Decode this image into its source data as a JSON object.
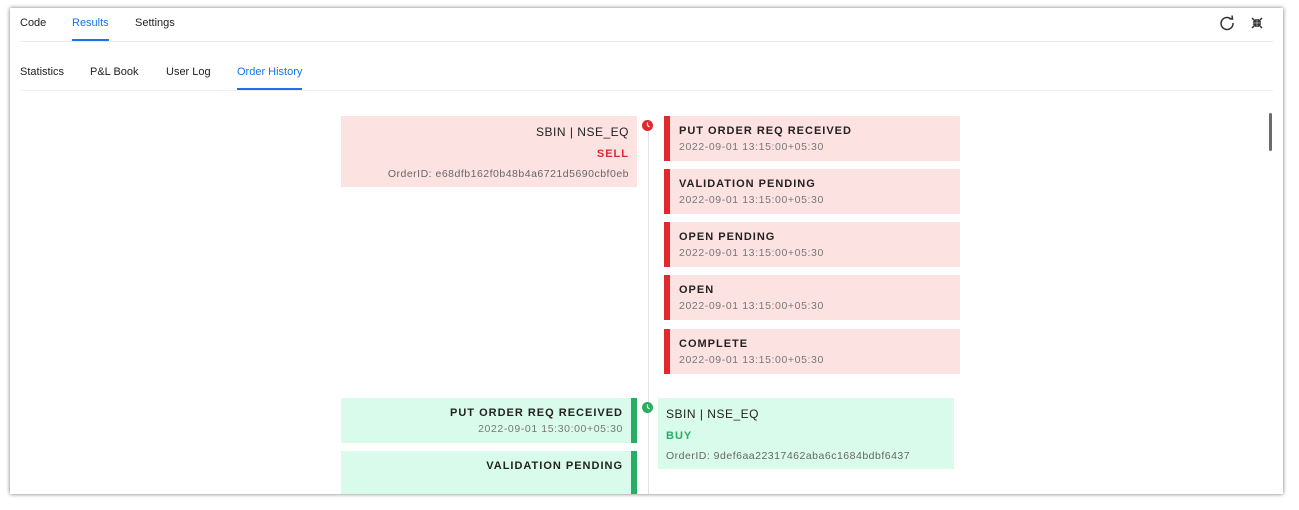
{
  "tabs": [
    {
      "label": "Code",
      "active": false
    },
    {
      "label": "Results",
      "active": true
    },
    {
      "label": "Settings",
      "active": false
    }
  ],
  "subtabs": [
    {
      "label": "Statistics",
      "active": false
    },
    {
      "label": "P&L Book",
      "active": false
    },
    {
      "label": "User Log",
      "active": false
    },
    {
      "label": "Order History",
      "active": true
    }
  ],
  "toolbar_icons": [
    "refresh-icon",
    "collapse-icon"
  ],
  "colors": {
    "accent": "#1a73e8",
    "sell": "#e0282e",
    "buy": "#27ae60",
    "sell_bg": "#fde2e2",
    "buy_bg": "#d9fbec"
  },
  "orders": [
    {
      "symbol": "SBIN | NSE_EQ",
      "side": "SELL",
      "order_id": "OrderID: e68dfb162f0b48b4a6721d5690cbf0eb",
      "statuses": [
        {
          "name": "PUT ORDER REQ RECEIVED",
          "time": "2022-09-01 13:15:00+05:30"
        },
        {
          "name": "VALIDATION PENDING",
          "time": "2022-09-01 13:15:00+05:30"
        },
        {
          "name": "OPEN PENDING",
          "time": "2022-09-01 13:15:00+05:30"
        },
        {
          "name": "OPEN",
          "time": "2022-09-01 13:15:00+05:30"
        },
        {
          "name": "COMPLETE",
          "time": "2022-09-01 13:15:00+05:30"
        }
      ]
    },
    {
      "symbol": "SBIN | NSE_EQ",
      "side": "BUY",
      "order_id": "OrderID: 9def6aa22317462aba6c1684bdbf6437",
      "statuses": [
        {
          "name": "PUT ORDER REQ RECEIVED",
          "time": "2022-09-01 15:30:00+05:30"
        },
        {
          "name": "VALIDATION PENDING",
          "time": ""
        }
      ]
    }
  ]
}
